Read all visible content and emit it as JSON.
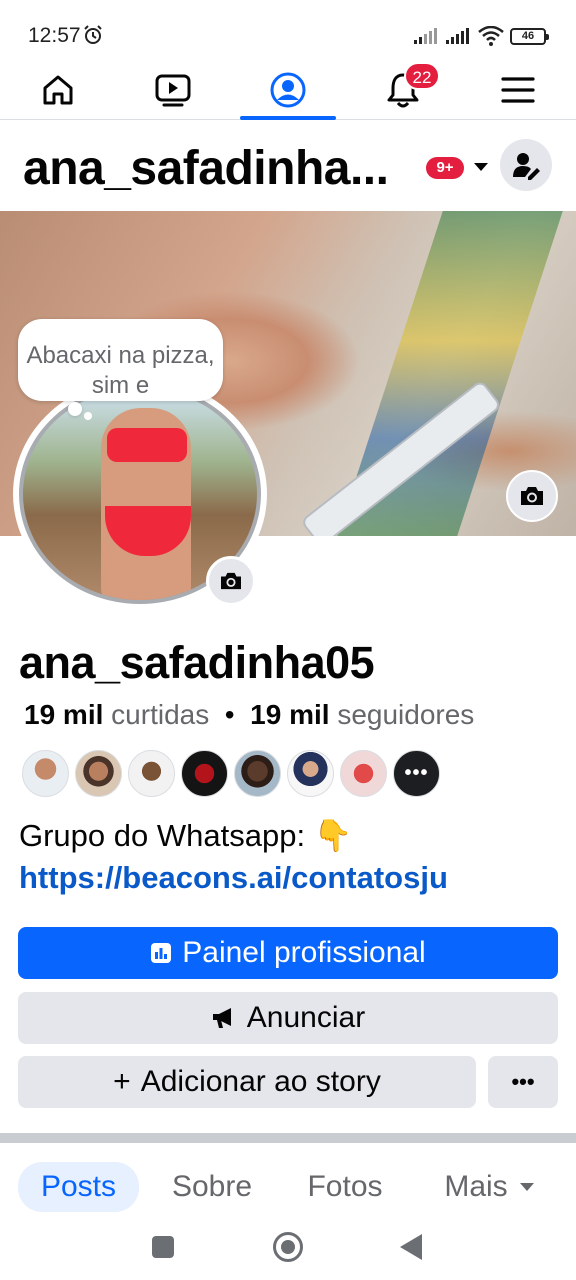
{
  "status_bar": {
    "time": "12:57",
    "battery": "46",
    "icons": [
      "alarm-icon",
      "signal-icon",
      "signal-icon",
      "wifi-icon",
      "battery-icon"
    ]
  },
  "top_nav": {
    "tabs": [
      "home-icon",
      "video-icon",
      "profile-icon",
      "notifications-icon",
      "menu-icon"
    ],
    "active": "profile-icon",
    "notification_count": "22",
    "accent_color": "#0866ff"
  },
  "header": {
    "name": "ana_safadinha...",
    "notif_badge": "9+"
  },
  "profile": {
    "note": "Abacaxi na pizza, sim e",
    "display_name": "ana_safadinha05",
    "likes_value": "19 mil",
    "likes_label": "curtidas",
    "separator": "•",
    "followers_value": "19 mil",
    "followers_label": "seguidores",
    "more_friends": "•••",
    "bio_text": "Grupo do Whatsapp: 👇",
    "bio_link": "https://beacons.ai/contatosju"
  },
  "buttons": {
    "dashboard": "Painel profissional",
    "advertise": "Anunciar",
    "add_story_plus": "+",
    "add_story": "Adicionar ao story",
    "more": "•••"
  },
  "profile_tabs": {
    "posts": "Posts",
    "about": "Sobre",
    "photos": "Fotos",
    "more": "Mais"
  }
}
